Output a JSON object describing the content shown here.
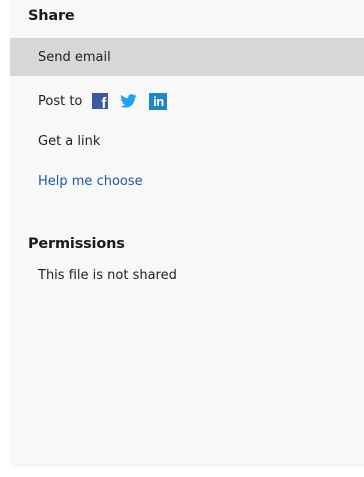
{
  "share": {
    "title": "Share",
    "send_email": "Send email",
    "post_to": "Post to",
    "social_icons": [
      "facebook-icon",
      "twitter-icon",
      "linkedin-icon"
    ],
    "facebook_glyph": "f",
    "linkedin_glyph": "in",
    "get_link": "Get a link",
    "help": "Help me choose"
  },
  "permissions": {
    "title": "Permissions",
    "status": "This file is not shared"
  },
  "colors": {
    "panel_background": "#f8f8f8",
    "selected_row": "#d7d7d7",
    "link": "#1a5aa6",
    "facebook": "#3b5a9a",
    "twitter": "#1da1f2",
    "linkedin": "#1c87c9"
  }
}
